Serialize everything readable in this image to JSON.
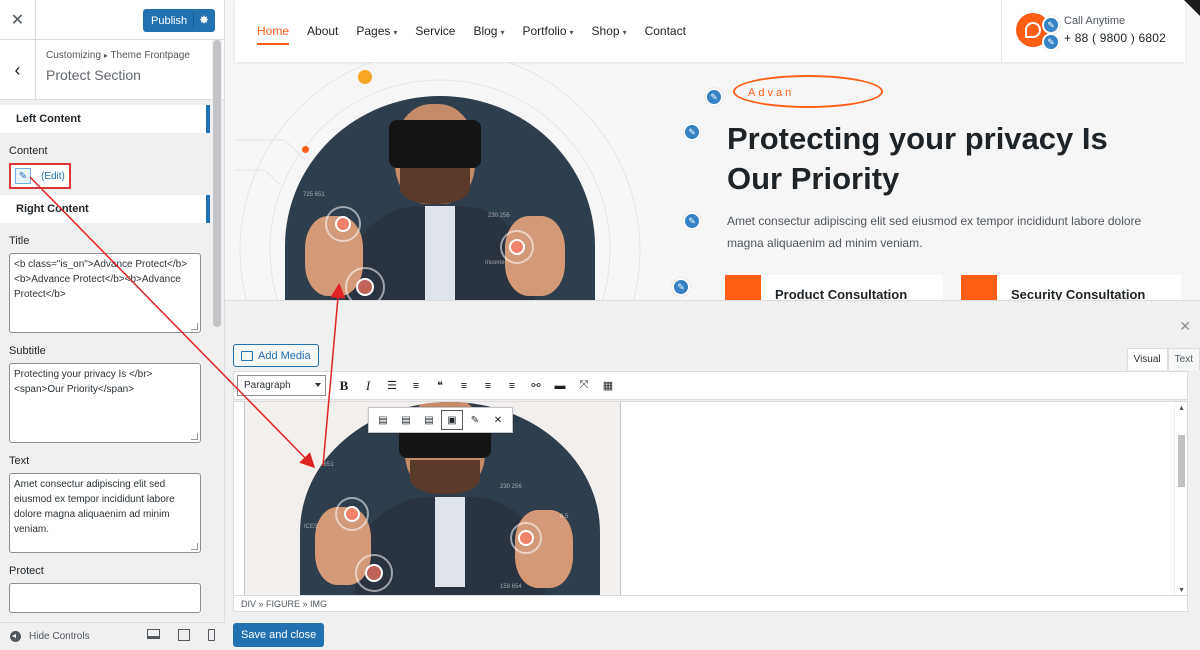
{
  "customizer": {
    "publish_label": "Publish",
    "breadcrumb_parent": "Customizing",
    "breadcrumb_sep": "▸",
    "breadcrumb_child": "Theme Frontpage",
    "section_title": "Protect Section",
    "left_content_heading": "Left Content",
    "content_label": "Content",
    "edit_link": "(Edit)",
    "right_content_heading": "Right Content",
    "title_label": "Title",
    "title_value": "<b class=\"is_on\">Advance Protect</b><b>Advance Protect</b><b>Advance Protect</b>",
    "subtitle_label": "Subtitle",
    "subtitle_value": "Protecting your privacy Is </br><span>Our Priority</span>",
    "text_label": "Text",
    "text_value": "Amet consectur adipiscing elit sed eiusmod ex tempor incididunt labore dolore magna aliquaenim ad minim veniam.",
    "protect_label": "Protect",
    "footer_hide_controls": "Hide Controls"
  },
  "site": {
    "nav": [
      {
        "label": "Home",
        "active": true,
        "dropdown": false
      },
      {
        "label": "About",
        "active": false,
        "dropdown": false
      },
      {
        "label": "Pages",
        "active": false,
        "dropdown": true
      },
      {
        "label": "Service",
        "active": false,
        "dropdown": false
      },
      {
        "label": "Blog",
        "active": false,
        "dropdown": true
      },
      {
        "label": "Portfolio",
        "active": false,
        "dropdown": true
      },
      {
        "label": "Shop",
        "active": false,
        "dropdown": true
      },
      {
        "label": "Contact",
        "active": false,
        "dropdown": false
      }
    ],
    "call_label": "Call Anytime",
    "call_phone": "+ 88 ( 9800 ) 6802",
    "badge": "Advan",
    "heading": "Protecting your privacy Is Our Priority",
    "description": "Amet consectur adipiscing elit sed eiusmod ex tempor incididunt labore dolore magna aliquaenim ad minim veniam.",
    "card1": "Product Consultation",
    "card2": "Security Consultation",
    "hud_labels": [
      "725 651",
      "230 256",
      "Income",
      "ICES",
      "0.5",
      "159 654"
    ]
  },
  "editor": {
    "add_media": "Add Media",
    "tab_visual": "Visual",
    "tab_text": "Text",
    "format_select": "Paragraph",
    "path": "DIV » FIGURE » IMG",
    "save_close": "Save and close"
  },
  "colors": {
    "accent": "#ff5e14",
    "wp_blue": "#2271b1",
    "annotation_red": "#e02424"
  }
}
